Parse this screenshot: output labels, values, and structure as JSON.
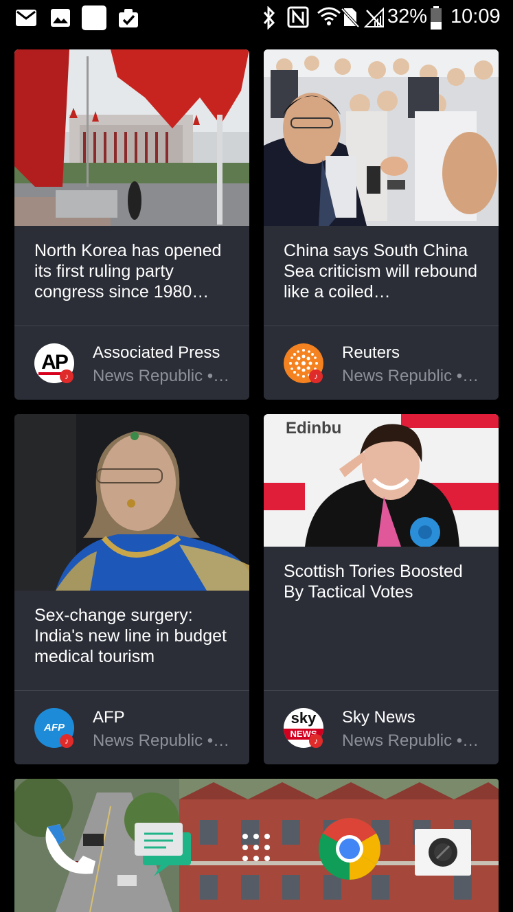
{
  "status_bar": {
    "battery_percent": "32%",
    "time": "10:09",
    "notification_icons": [
      "mail-icon",
      "image-icon",
      "blank-square-icon",
      "clipboard-check-icon"
    ],
    "system_icons": [
      "bluetooth-icon",
      "nfc-icon",
      "wifi-icon",
      "no-sim-icon",
      "no-signal-icon",
      "battery-icon"
    ]
  },
  "cards": [
    {
      "headline": "North Korea has opened its first ruling party congress since 1980…",
      "source": "Associated Press",
      "app": "News Republic •…",
      "logo_text": "AP"
    },
    {
      "headline": "China says South China Sea criticism will rebound like a coiled…",
      "source": "Reuters",
      "app": "News Republic •…",
      "logo_text": ""
    },
    {
      "headline": "Sex-change surgery: India's new line in budget medical tourism",
      "source": "AFP",
      "app": "News Republic •…",
      "logo_text": "AFP"
    },
    {
      "headline": "Scottish Tories Boosted By Tactical Votes",
      "source": "Sky News",
      "app": "News Republic •…",
      "logo_text": "sky",
      "logo_text2": "NEWS",
      "image_text": "Edinbu"
    }
  ],
  "dock": {
    "apps": [
      "phone-icon",
      "messages-icon",
      "app-drawer-icon",
      "chrome-icon",
      "camera-icon"
    ]
  },
  "colors": {
    "card_bg": "#2b2e37",
    "secondary_text": "#8d9099",
    "badge_red": "#e02b2b"
  }
}
